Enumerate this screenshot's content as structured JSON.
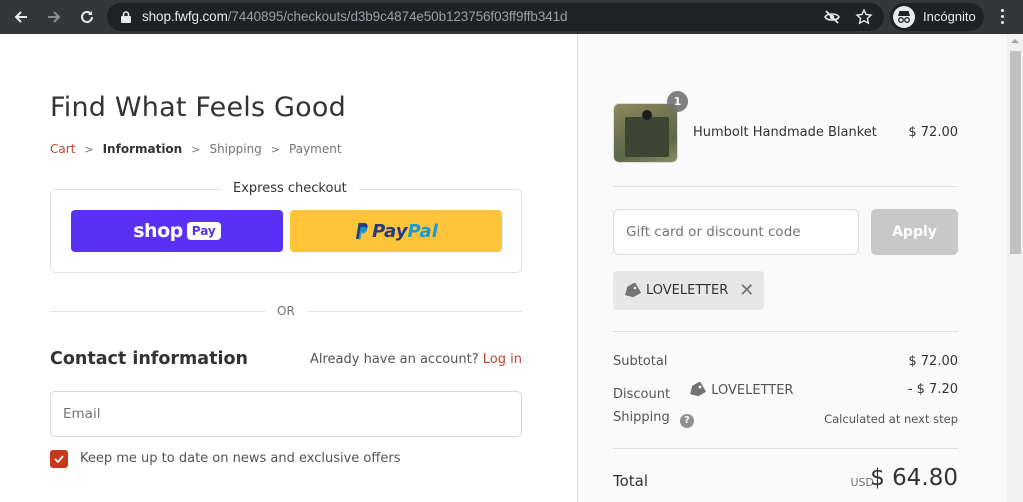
{
  "browser": {
    "url_host": "shop.fwfg.com",
    "url_path": "/7440895/checkouts/d3b9c4874e50b123756f03ff9ffb341d",
    "incognito_label": "Incógnito",
    "icons": [
      "back-icon",
      "forward-icon",
      "reload-icon",
      "lock-icon",
      "eye-off-icon",
      "star-icon",
      "incognito-icon",
      "kebab-menu-icon"
    ]
  },
  "main": {
    "shop_title": "Find What Feels Good",
    "breadcrumb": [
      {
        "label": "Cart",
        "state": "link"
      },
      {
        "label": "Information",
        "state": "current"
      },
      {
        "label": "Shipping",
        "state": "upcoming"
      },
      {
        "label": "Payment",
        "state": "upcoming"
      }
    ],
    "breadcrumb_separator": ">",
    "express_checkout": {
      "title": "Express checkout",
      "shop_pay": {
        "word": "shop",
        "pill": "Pay",
        "color": "#5a31f4"
      },
      "paypal": {
        "pay": "Pay",
        "pal": "Pal",
        "color": "#ffc439"
      }
    },
    "or_label": "OR",
    "contact": {
      "title": "Contact information",
      "account_prompt": "Already have an account?",
      "login_link": "Log in",
      "email_placeholder": "Email",
      "email_value": "",
      "newsletter_label": "Keep me up to date on news and exclusive offers",
      "newsletter_checked": true
    },
    "accent_color": "#c1432e"
  },
  "summary": {
    "product": {
      "name": "Humbolt Handmade Blanket",
      "price": "$ 72.00",
      "quantity": "1"
    },
    "discount_input": {
      "placeholder": "Gift card or discount code",
      "value": ""
    },
    "apply_label": "Apply",
    "applied_code": "LOVELETTER",
    "remove_symbol": "✕",
    "subtotal_label": "Subtotal",
    "subtotal_value": "$ 72.00",
    "discount_label": "Discount",
    "discount_code": "LOVELETTER",
    "discount_value": "- $ 7.20",
    "shipping_label": "Shipping",
    "shipping_help": "?",
    "shipping_value": "Calculated at next step",
    "total_label": "Total",
    "total_currency": "USD",
    "total_value": "$ 64.80"
  }
}
